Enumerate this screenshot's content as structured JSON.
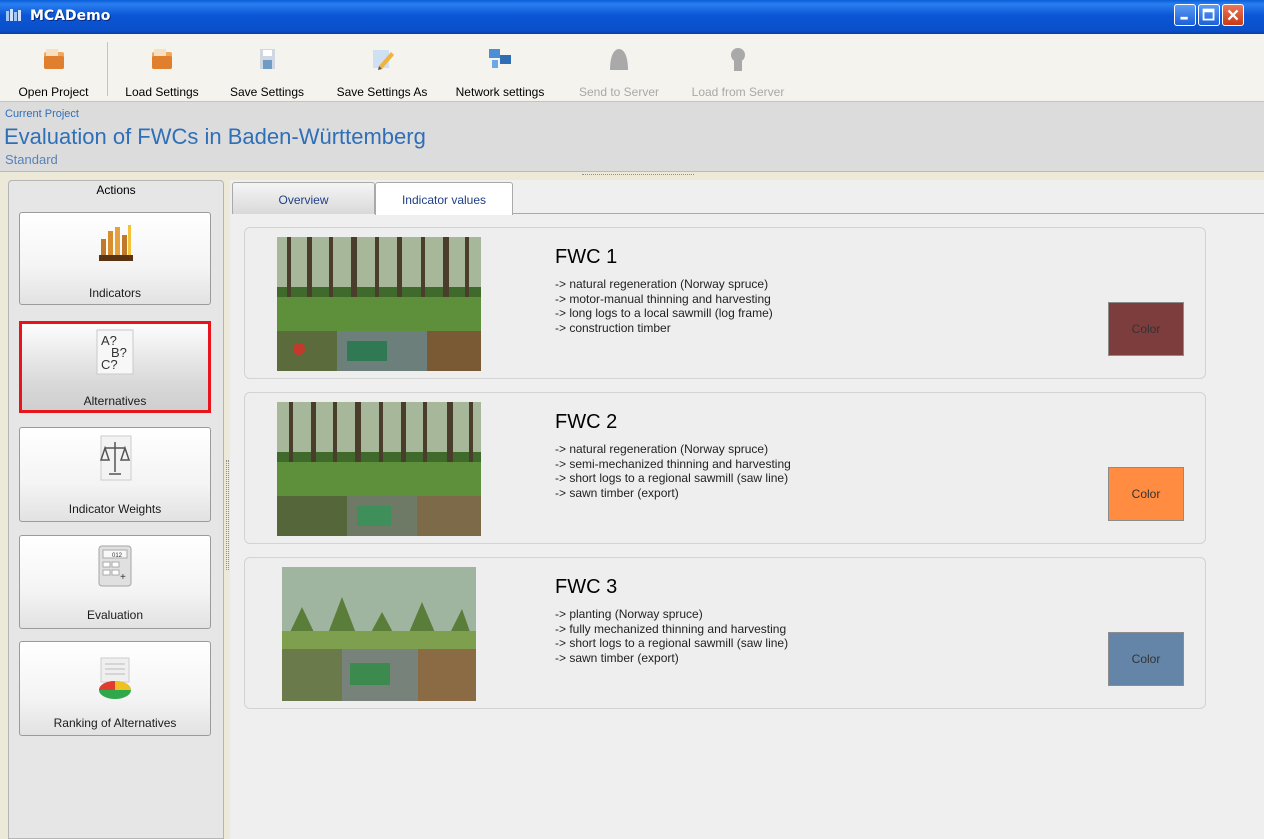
{
  "window": {
    "title": "MCADemo"
  },
  "toolbar": {
    "items": [
      {
        "label": "Open Project",
        "icon": "folder-open-icon",
        "enabled": true
      },
      {
        "label": "Load Settings",
        "icon": "load-settings-icon",
        "enabled": true
      },
      {
        "label": "Save Settings",
        "icon": "save-disk-icon",
        "enabled": true
      },
      {
        "label": "Save Settings As",
        "icon": "save-as-pencil-icon",
        "enabled": true
      },
      {
        "label": "Network settings",
        "icon": "network-computers-icon",
        "enabled": true
      },
      {
        "label": "Send to Server",
        "icon": "send-to-server-icon",
        "enabled": false
      },
      {
        "label": "Load from Server",
        "icon": "load-from-server-icon",
        "enabled": false
      }
    ]
  },
  "project": {
    "caption": "Current Project",
    "name": "Evaluation of FWCs in Baden-Württemberg",
    "variant": "Standard"
  },
  "actions": {
    "header": "Actions",
    "items": [
      {
        "label": "Indicators",
        "icon": "bar-chart-icon",
        "selected": false
      },
      {
        "label": "Alternatives",
        "icon": "question-letters-icon",
        "selected": true
      },
      {
        "label": "Indicator Weights",
        "icon": "balance-scale-icon",
        "selected": false
      },
      {
        "label": "Evaluation",
        "icon": "calculator-icon",
        "selected": false
      },
      {
        "label": "Ranking of Alternatives",
        "icon": "pie-chart-icon",
        "selected": false
      }
    ]
  },
  "tabs": [
    {
      "label": "Overview",
      "active": false
    },
    {
      "label": "Indicator values",
      "active": true
    }
  ],
  "alternatives": [
    {
      "name": "FWC 1",
      "lines": [
        "-> natural regeneration (Norway spruce)",
        "-> motor-manual thinning and harvesting",
        "-> long logs to a local sawmill (log frame)",
        "-> construction timber"
      ],
      "color_label": "Color",
      "color": "#7d3d3d"
    },
    {
      "name": "FWC 2",
      "lines": [
        "-> natural regeneration (Norway spruce)",
        "-> semi-mechanized thinning and harvesting",
        "-> short logs to a regional sawmill (saw line)",
        "-> sawn timber (export)"
      ],
      "color_label": "Color",
      "color": "#ff8c40"
    },
    {
      "name": "FWC 3",
      "lines": [
        "-> planting (Norway spruce)",
        "-> fully mechanized thinning and harvesting",
        "-> short logs to a regional sawmill (saw line)",
        "-> sawn timber (export)"
      ],
      "color_label": "Color",
      "color": "#6485a8"
    }
  ],
  "colors": {
    "titlebar": "#0b56d6",
    "project_text": "#2f6fb8",
    "selected_border": "#e8141c"
  }
}
